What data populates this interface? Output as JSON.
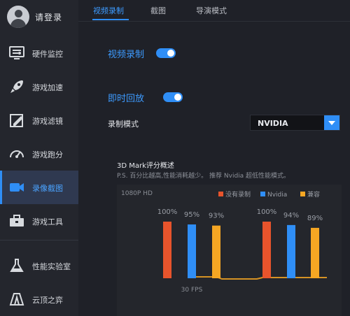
{
  "sidebar": {
    "login_label": "请登录",
    "items": [
      {
        "label": "硬件监控",
        "icon": "hardware-monitor-icon"
      },
      {
        "label": "游戏加速",
        "icon": "rocket-icon"
      },
      {
        "label": "游戏滤镜",
        "icon": "filter-edit-icon"
      },
      {
        "label": "游戏跑分",
        "icon": "speedometer-icon"
      },
      {
        "label": "录像截图",
        "icon": "video-camera-icon"
      },
      {
        "label": "游戏工具",
        "icon": "toolbox-icon"
      },
      {
        "label": "性能实验室",
        "icon": "flask-icon"
      },
      {
        "label": "云顶之弈",
        "icon": "tft-icon"
      }
    ],
    "active_index": 4
  },
  "tabs": [
    {
      "label": "视频录制"
    },
    {
      "label": "截图"
    },
    {
      "label": "导演模式"
    }
  ],
  "settings": {
    "video_record_label": "视频录制",
    "video_record_on": true,
    "instant_replay_label": "即时回放",
    "instant_replay_on": true,
    "record_mode_label": "录制模式",
    "record_mode_value": "NVIDIA"
  },
  "benchmark": {
    "title": "3D Mark评分概述",
    "note": "P.S. 百分比越高,性能消耗越少。 推荐 Nvidia 超低性能模式。",
    "resolution": "1080P HD",
    "fps_label": "30 FPS"
  },
  "colors": {
    "accent": "#2f8ef6",
    "no_record": "#e8542c",
    "nvidia": "#2f8ef6",
    "compatible": "#f5a623"
  },
  "chart_data": {
    "type": "bar",
    "legend": [
      "没有录制",
      "Nvidia",
      "兼容"
    ],
    "groups": [
      {
        "values": [
          100,
          95,
          93
        ],
        "labels": [
          "100%",
          "95%",
          "93%"
        ]
      },
      {
        "values": [
          100,
          94,
          89
        ],
        "labels": [
          "100%",
          "94%",
          "89%"
        ]
      }
    ],
    "xlabel": "30 FPS"
  }
}
